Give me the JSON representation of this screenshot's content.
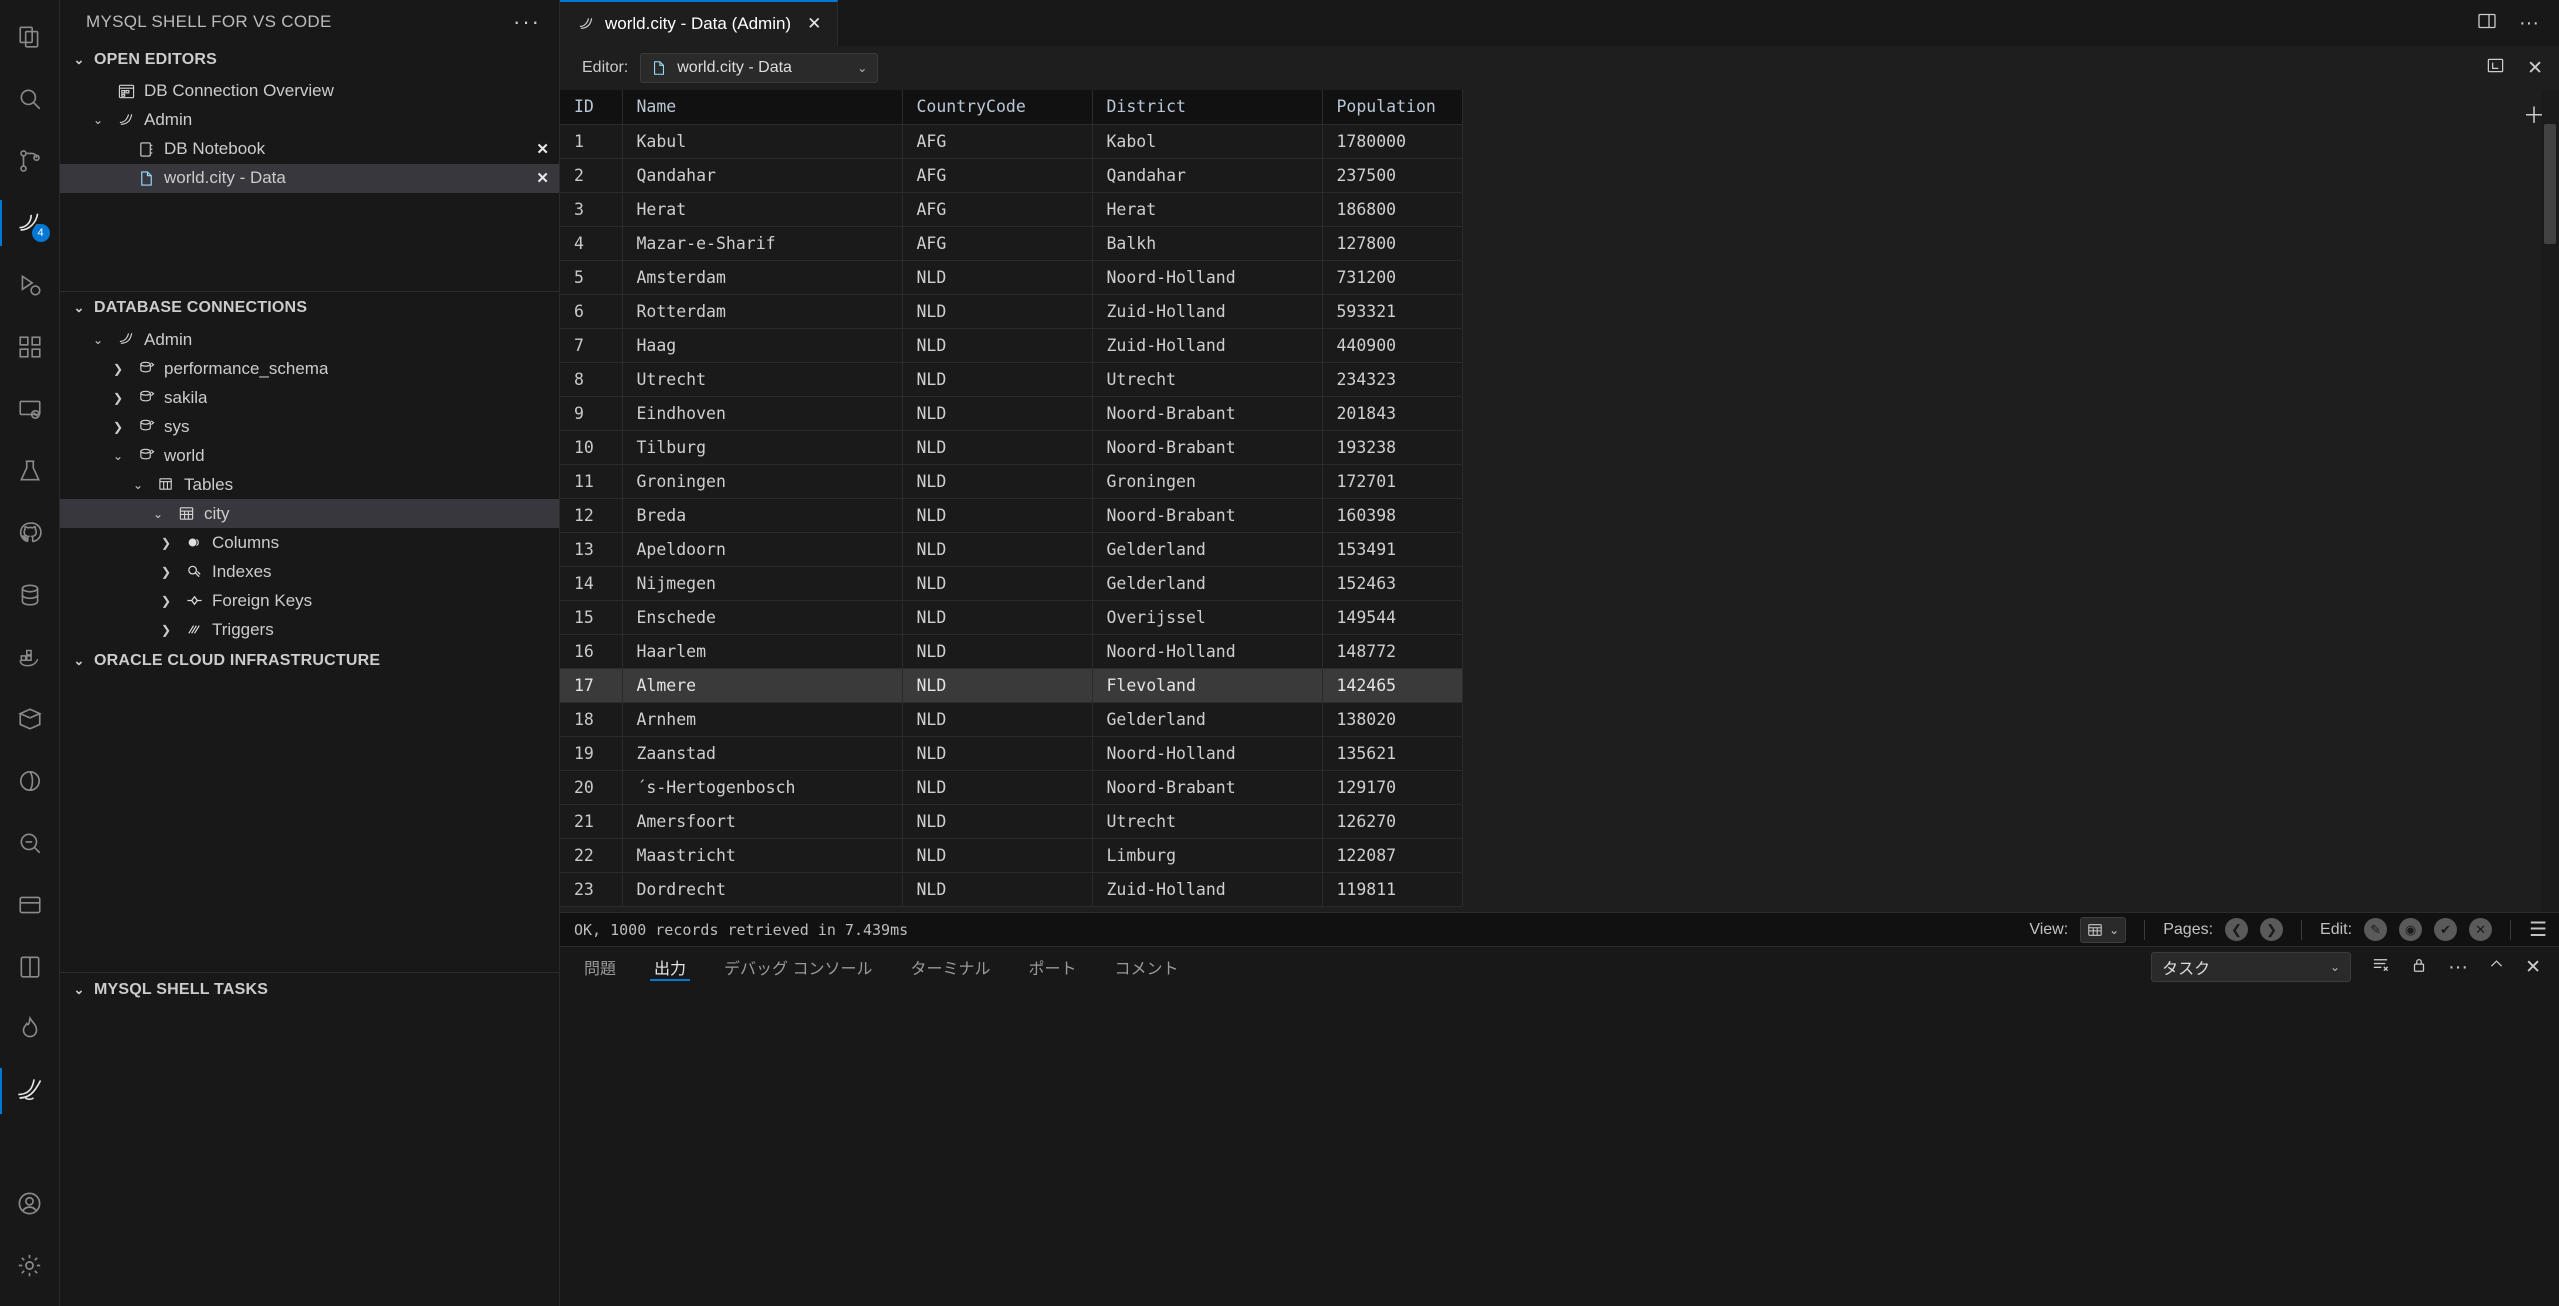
{
  "activity_bar": {
    "items": [
      {
        "name": "explorer",
        "icon": "files-icon"
      },
      {
        "name": "search",
        "icon": "search-icon"
      },
      {
        "name": "source-control",
        "icon": "source-control-icon"
      },
      {
        "name": "mysql-shell",
        "icon": "mysql-shell-icon",
        "badge": "4"
      },
      {
        "name": "run-debug",
        "icon": "run-debug-icon"
      },
      {
        "name": "extensions",
        "icon": "extensions-icon"
      },
      {
        "name": "remote-explorer",
        "icon": "remote-explorer-icon"
      },
      {
        "name": "testing",
        "icon": "beaker-icon"
      },
      {
        "name": "github",
        "icon": "github-icon"
      },
      {
        "name": "database",
        "icon": "database-icon"
      },
      {
        "name": "docker",
        "icon": "docker-icon"
      },
      {
        "name": "package",
        "icon": "package-icon"
      },
      {
        "name": "circle-tool",
        "icon": "circle-icon"
      },
      {
        "name": "query-tool",
        "icon": "query-icon"
      },
      {
        "name": "card-tool",
        "icon": "card-icon"
      },
      {
        "name": "book-tool",
        "icon": "book-icon"
      },
      {
        "name": "flame-tool",
        "icon": "flame-icon"
      },
      {
        "name": "dolphin-tool",
        "icon": "dolphin-icon"
      }
    ],
    "bottom_items": [
      {
        "name": "accounts",
        "icon": "account-icon"
      },
      {
        "name": "settings",
        "icon": "gear-icon"
      }
    ],
    "active_index": 3,
    "badge_value": "4",
    "accent_color": "#0078d4"
  },
  "sidebar": {
    "title": "MYSQL SHELL FOR VS CODE",
    "more_actions": "···",
    "sections": [
      {
        "id": "open-editors",
        "label": "OPEN EDITORS",
        "expanded": true,
        "items": [
          {
            "label": "DB Connection Overview",
            "icon": "db-overview-icon",
            "indent": 1,
            "twist": "",
            "close": false
          },
          {
            "label": "Admin",
            "icon": "mysql-conn-icon",
            "indent": 1,
            "twist": "v",
            "close": false
          },
          {
            "label": "DB Notebook",
            "icon": "notebook-icon",
            "indent": 2,
            "twist": "",
            "close": true
          },
          {
            "label": "world.city - Data",
            "icon": "data-icon",
            "indent": 2,
            "twist": "",
            "close": true,
            "selected": true
          }
        ]
      },
      {
        "id": "database-connections",
        "label": "DATABASE CONNECTIONS",
        "expanded": true,
        "items": [
          {
            "label": "Admin",
            "icon": "mysql-conn-icon",
            "indent": 1,
            "twist": "v"
          },
          {
            "label": "performance_schema",
            "icon": "schema-icon",
            "indent": 2,
            "twist": ">"
          },
          {
            "label": "sakila",
            "icon": "schema-icon",
            "indent": 2,
            "twist": ">"
          },
          {
            "label": "sys",
            "icon": "schema-icon",
            "indent": 2,
            "twist": ">"
          },
          {
            "label": "world",
            "icon": "schema-icon",
            "indent": 2,
            "twist": "v"
          },
          {
            "label": "Tables",
            "icon": "tables-icon",
            "indent": 3,
            "twist": "v"
          },
          {
            "label": "city",
            "icon": "table-icon",
            "indent": 4,
            "twist": "v",
            "selected": true
          },
          {
            "label": "Columns",
            "icon": "columns-icon",
            "indent": 5,
            "twist": ">"
          },
          {
            "label": "Indexes",
            "icon": "indexes-icon",
            "indent": 5,
            "twist": ">"
          },
          {
            "label": "Foreign Keys",
            "icon": "foreign-keys-icon",
            "indent": 5,
            "twist": ">"
          },
          {
            "label": "Triggers",
            "icon": "triggers-icon",
            "indent": 5,
            "twist": ">"
          }
        ]
      },
      {
        "id": "oracle-cloud-infrastructure",
        "label": "ORACLE CLOUD INFRASTRUCTURE",
        "expanded": true,
        "items": []
      },
      {
        "id": "mysql-shell-tasks",
        "label": "MYSQL SHELL TASKS",
        "expanded": true,
        "items": []
      }
    ]
  },
  "editor": {
    "tab": {
      "title": "world.city - Data (Admin)",
      "icon": "data-icon",
      "close": "✕"
    },
    "tab_actions": [
      {
        "name": "split-editor",
        "glyph": "▥"
      },
      {
        "name": "more-actions",
        "glyph": "···"
      }
    ],
    "toolbar": {
      "label": "Editor:",
      "selected": "world.city - Data",
      "select_icon": "data-icon",
      "chevron": "⌄",
      "right_actions": [
        {
          "name": "maximize-panel",
          "glyph": "⛶"
        },
        {
          "name": "close-editor",
          "glyph": "✕"
        }
      ]
    },
    "grid": {
      "add_column": "＋",
      "columns": [
        "ID",
        "Name",
        "CountryCode",
        "District",
        "Population"
      ],
      "selected_row_index": 16,
      "rows": [
        [
          "1",
          "Kabul",
          "AFG",
          "Kabol",
          "1780000"
        ],
        [
          "2",
          "Qandahar",
          "AFG",
          "Qandahar",
          "237500"
        ],
        [
          "3",
          "Herat",
          "AFG",
          "Herat",
          "186800"
        ],
        [
          "4",
          "Mazar-e-Sharif",
          "AFG",
          "Balkh",
          "127800"
        ],
        [
          "5",
          "Amsterdam",
          "NLD",
          "Noord-Holland",
          "731200"
        ],
        [
          "6",
          "Rotterdam",
          "NLD",
          "Zuid-Holland",
          "593321"
        ],
        [
          "7",
          "Haag",
          "NLD",
          "Zuid-Holland",
          "440900"
        ],
        [
          "8",
          "Utrecht",
          "NLD",
          "Utrecht",
          "234323"
        ],
        [
          "9",
          "Eindhoven",
          "NLD",
          "Noord-Brabant",
          "201843"
        ],
        [
          "10",
          "Tilburg",
          "NLD",
          "Noord-Brabant",
          "193238"
        ],
        [
          "11",
          "Groningen",
          "NLD",
          "Groningen",
          "172701"
        ],
        [
          "12",
          "Breda",
          "NLD",
          "Noord-Brabant",
          "160398"
        ],
        [
          "13",
          "Apeldoorn",
          "NLD",
          "Gelderland",
          "153491"
        ],
        [
          "14",
          "Nijmegen",
          "NLD",
          "Gelderland",
          "152463"
        ],
        [
          "15",
          "Enschede",
          "NLD",
          "Overijssel",
          "149544"
        ],
        [
          "16",
          "Haarlem",
          "NLD",
          "Noord-Holland",
          "148772"
        ],
        [
          "17",
          "Almere",
          "NLD",
          "Flevoland",
          "142465"
        ],
        [
          "18",
          "Arnhem",
          "NLD",
          "Gelderland",
          "138020"
        ],
        [
          "19",
          "Zaanstad",
          "NLD",
          "Noord-Holland",
          "135621"
        ],
        [
          "20",
          "´s-Hertogenbosch",
          "NLD",
          "Noord-Brabant",
          "129170"
        ],
        [
          "21",
          "Amersfoort",
          "NLD",
          "Utrecht",
          "126270"
        ],
        [
          "22",
          "Maastricht",
          "NLD",
          "Limburg",
          "122087"
        ],
        [
          "23",
          "Dordrecht",
          "NLD",
          "Zuid-Holland",
          "119811"
        ]
      ]
    },
    "result_status": {
      "message": "OK, 1000 records retrieved in 7.439ms",
      "view_label": "View:",
      "view_icon": "grid-view-icon",
      "view_chevron": "⌄",
      "pages_label": "Pages:",
      "page_prev": "❮",
      "page_next": "❯",
      "edit_label": "Edit:",
      "edit_buttons": [
        {
          "name": "edit-pencil-button",
          "glyph": "✎"
        },
        {
          "name": "preview-eye-button",
          "glyph": "◉"
        },
        {
          "name": "apply-check-button",
          "glyph": "✔"
        },
        {
          "name": "cancel-x-button",
          "glyph": "✕"
        }
      ],
      "menu": "☰"
    }
  },
  "panel": {
    "tabs": [
      {
        "label": "問題",
        "active": false
      },
      {
        "label": "出力",
        "active": true
      },
      {
        "label": "デバッグ コンソール",
        "active": false
      },
      {
        "label": "ターミナル",
        "active": false
      },
      {
        "label": "ポート",
        "active": false
      },
      {
        "label": "コメント",
        "active": false
      }
    ],
    "channel_select": {
      "value": "タスク",
      "chevron": "⌄"
    },
    "actions": [
      {
        "name": "clear-output-button",
        "glyph": "≡"
      },
      {
        "name": "lock-scroll-button",
        "glyph": "🔒"
      },
      {
        "name": "panel-more-button",
        "glyph": "···"
      },
      {
        "name": "maximize-panel-button",
        "glyph": "⌃"
      },
      {
        "name": "close-panel-button",
        "glyph": "✕"
      }
    ],
    "body_text": ""
  },
  "theme": {
    "bg": "#1e1e1e",
    "sidebar_bg": "#181818",
    "accent": "#0078d4",
    "selection": "#37373d",
    "row_selected": "#3a3a3a",
    "text": "#cccccc"
  }
}
